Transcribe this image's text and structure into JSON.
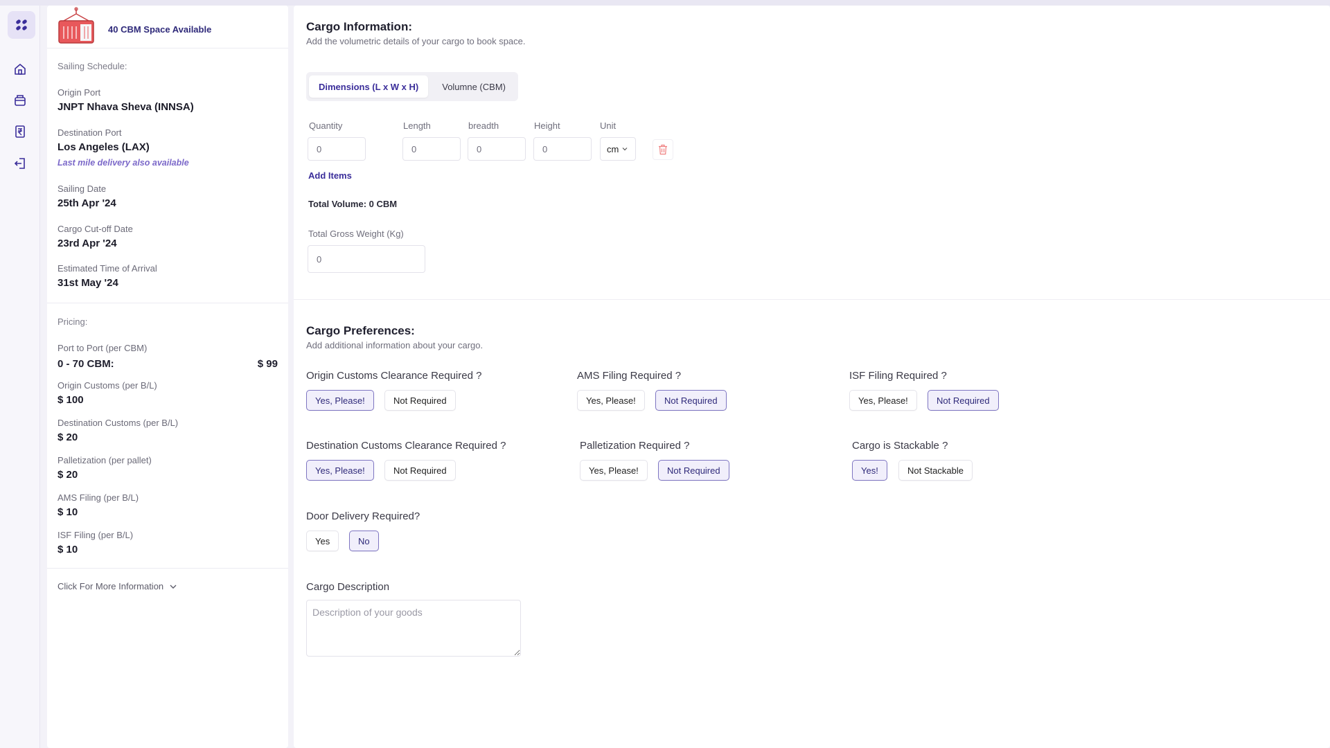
{
  "colors": {
    "accent": "#3a2d9a",
    "accent_light": "#f1effb",
    "accent_border": "#7e75c2",
    "container_red": "#e8585b",
    "link_italic": "#7b68c9"
  },
  "rail": {
    "items": [
      "home-icon",
      "box-icon",
      "invoice-icon",
      "logout-icon"
    ]
  },
  "summary": {
    "space_text": "40 CBM Space Available",
    "sailing_label": "Sailing Schedule:",
    "origin_label": "Origin Port",
    "origin_value": "JNPT Nhava Sheva (INNSA)",
    "dest_label": "Destination Port",
    "dest_value": "Los Angeles (LAX)",
    "last_mile": "Last mile delivery also available",
    "sailing_date_label": "Sailing Date",
    "sailing_date_value": "25th Apr '24",
    "cutoff_label": "Cargo Cut-off Date",
    "cutoff_value": "23rd Apr '24",
    "eta_label": "Estimated Time of Arrival",
    "eta_value": "31st May '24",
    "pricing_label": "Pricing:",
    "p2p_label": "Port to Port (per CBM)",
    "p2p_range": "0 - 70 CBM:",
    "p2p_price": "$ 99",
    "oc_label": "Origin Customs (per B/L)",
    "oc_value": "$ 100",
    "dc_label": "Destination Customs (per B/L)",
    "dc_value": "$ 20",
    "pal_label": "Palletization (per pallet)",
    "pal_value": "$ 20",
    "ams_label": "AMS Filing (per B/L)",
    "ams_value": "$ 10",
    "isf_label": "ISF Filing (per B/L)",
    "isf_value": "$ 10",
    "more": "Click For More Information"
  },
  "cargo_info": {
    "title": "Cargo Information:",
    "subtitle": "Add the volumetric details of your cargo to book space.",
    "tab_dimensions": "Dimensions (L x W x H)",
    "tab_volume": "Volumne (CBM)",
    "quantity_label": "Quantity",
    "length_label": "Length",
    "breadth_label": "breadth",
    "height_label": "Height",
    "unit_label": "Unit",
    "quantity": "0",
    "length": "0",
    "breadth": "0",
    "height": "0",
    "unit": "cm",
    "add_items": "Add Items",
    "total_volume": "Total Volume: 0 CBM",
    "gross_weight_label": "Total Gross Weight (Kg)",
    "gross_weight": "0"
  },
  "prefs": {
    "title": "Cargo Preferences:",
    "subtitle": "Add additional information about your cargo.",
    "origin_customs_q": "Origin Customs Clearance Required ?",
    "ams_q": "AMS Filing Required ?",
    "isf_q": "ISF Filing Required ?",
    "dest_customs_q": "Destination Customs Clearance Required ?",
    "pallet_q": "Palletization Required ?",
    "stack_q": "Cargo is Stackable ?",
    "door_q": "Door Delivery Required?",
    "yes_please": "Yes, Please!",
    "not_required": "Not Required",
    "yes_excl": "Yes!",
    "not_stackable": "Not Stackable",
    "yes": "Yes",
    "no": "No",
    "desc_label": "Cargo Description",
    "desc_placeholder": "Description of your goods"
  }
}
